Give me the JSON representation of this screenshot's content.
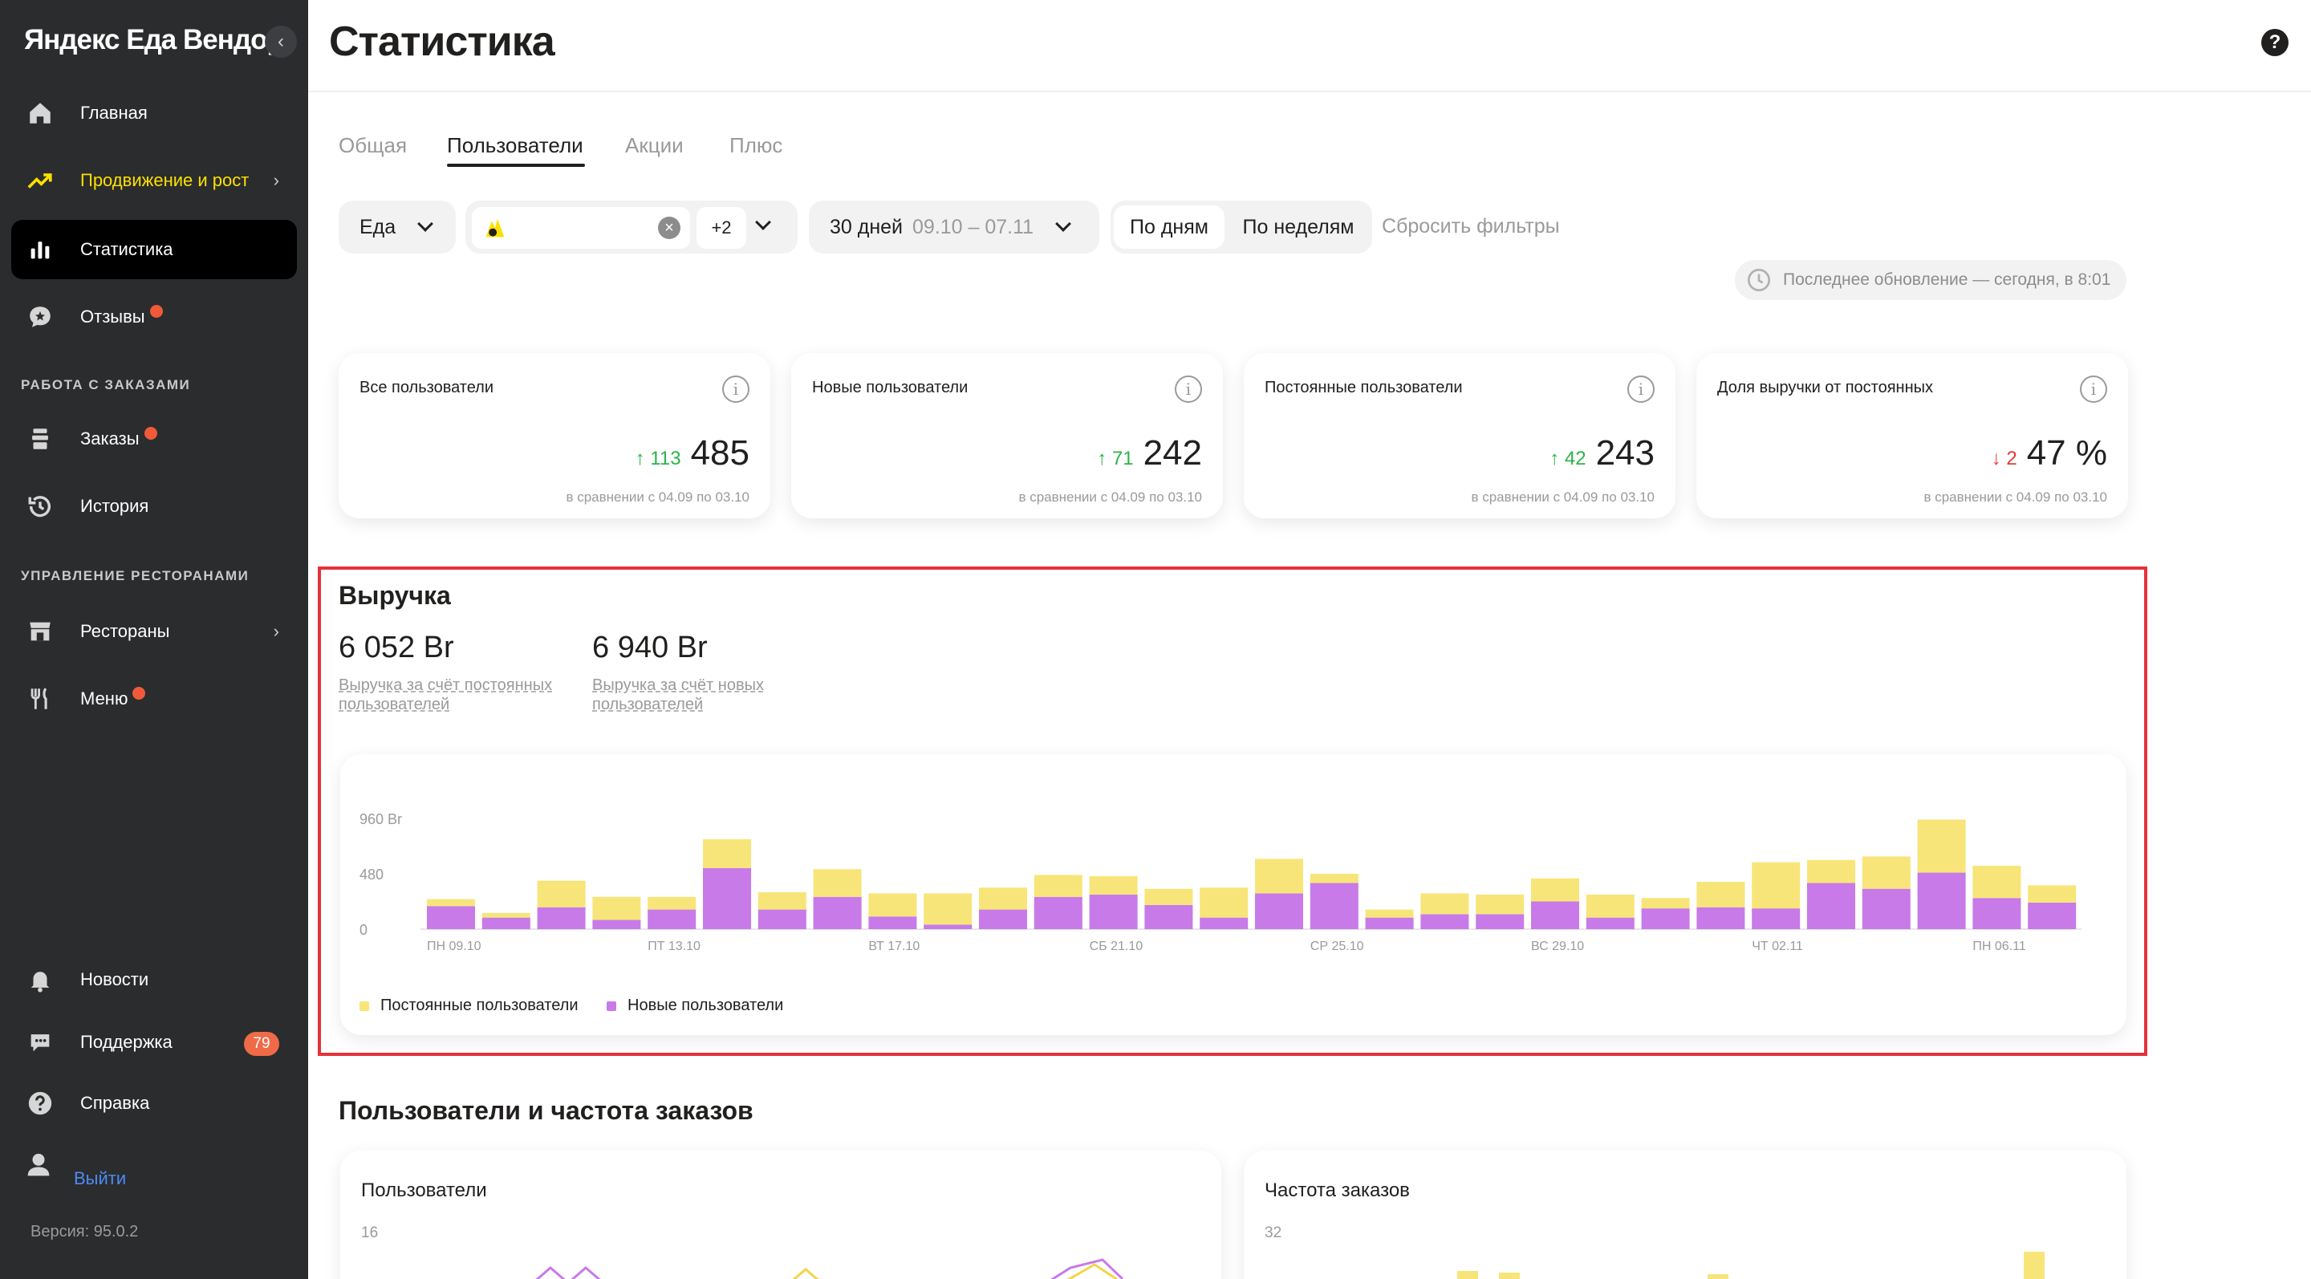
{
  "sidebar": {
    "logo": "Яндекс Еда Вендор",
    "collapse": "‹",
    "items": [
      {
        "label": "Главная"
      },
      {
        "label": "Продвижение и рост"
      },
      {
        "label": "Статистика"
      },
      {
        "label": "Отзывы"
      },
      {
        "label": "Заказы"
      },
      {
        "label": "История"
      },
      {
        "label": "Рестораны"
      },
      {
        "label": "Меню"
      },
      {
        "label": "Новости"
      },
      {
        "label": "Поддержка",
        "badge": "79"
      },
      {
        "label": "Справка"
      }
    ],
    "sections": [
      "РАБОТА С ЗАКАЗАМИ",
      "УПРАВЛЕНИЕ РЕСТОРАНАМИ"
    ],
    "logout": "Выйти",
    "version": "Версия: 95.0.2"
  },
  "header": {
    "title": "Статистика",
    "help": "?"
  },
  "tabs": [
    {
      "label": "Общая"
    },
    {
      "label": "Пользователи",
      "active": true
    },
    {
      "label": "Акции"
    },
    {
      "label": "Плюс"
    }
  ],
  "filters": {
    "service": "Еда",
    "extra_count": "+2",
    "clear": "×",
    "period_label": "30 дней",
    "period_range": "09.10 – 07.11",
    "by_days": "По дням",
    "by_weeks": "По неделям",
    "reset": "Сбросить фильтры",
    "last_update": "Последнее обновление — сегодня, в 8:01"
  },
  "kpis": [
    {
      "title": "Все пользователи",
      "delta": "↑ 113",
      "dir": "up",
      "value": "485",
      "compare": "в сравнении с 04.09 по 03.10"
    },
    {
      "title": "Новые пользователи",
      "delta": "↑ 71",
      "dir": "up",
      "value": "242",
      "compare": "в сравнении с 04.09 по 03.10"
    },
    {
      "title": "Постоянные пользователи",
      "delta": "↑ 42",
      "dir": "up",
      "value": "243",
      "compare": "в сравнении с 04.09 по 03.10"
    },
    {
      "title": "Доля выручки от постоянных",
      "delta": "↓ 2",
      "dir": "down",
      "value": "47 %",
      "compare": "в сравнении с 04.09 по 03.10"
    }
  ],
  "revenue": {
    "title": "Выручка",
    "regular_amount": "6 052 Br",
    "regular_label": "Выручка за счёт постоянных пользователей",
    "new_amount": "6 940 Br",
    "new_label": "Выручка за счёт новых пользователей"
  },
  "colors": {
    "regular": "#f7e57a",
    "new": "#c77ae8",
    "accent_yellow": "#fce000"
  },
  "chart_data": {
    "type": "bar",
    "stacked": true,
    "y_tick_labels": [
      "960 Br",
      "480",
      "0"
    ],
    "y_ticks": [
      960,
      480,
      0
    ],
    "ylim": [
      0,
      960
    ],
    "x_tick_labels": [
      "ПН 09.10",
      "ПТ 13.10",
      "ВТ 17.10",
      "СБ 21.10",
      "СР 25.10",
      "ВС 29.10",
      "ЧТ 02.11",
      "ПН 06.11"
    ],
    "x_tick_positions": [
      0,
      4,
      8,
      12,
      16,
      20,
      24,
      28
    ],
    "series": [
      {
        "name": "Новые пользователи",
        "values": [
          200,
          100,
          190,
          80,
          170,
          530,
          170,
          280,
          110,
          40,
          170,
          280,
          300,
          210,
          100,
          310,
          400,
          100,
          130,
          130,
          240,
          100,
          180,
          190,
          180,
          400,
          350,
          490,
          270,
          230
        ]
      },
      {
        "name": "Постоянные пользователи",
        "values": [
          60,
          40,
          230,
          200,
          110,
          250,
          150,
          240,
          200,
          270,
          190,
          190,
          160,
          140,
          260,
          300,
          80,
          70,
          180,
          170,
          200,
          200,
          90,
          220,
          400,
          200,
          280,
          460,
          280,
          150
        ]
      }
    ]
  },
  "bottom": {
    "title": "Пользователи и частота заказов",
    "users_title": "Пользователи",
    "users_axis": "16",
    "freq_title": "Частота заказов",
    "freq_axis": "32"
  }
}
